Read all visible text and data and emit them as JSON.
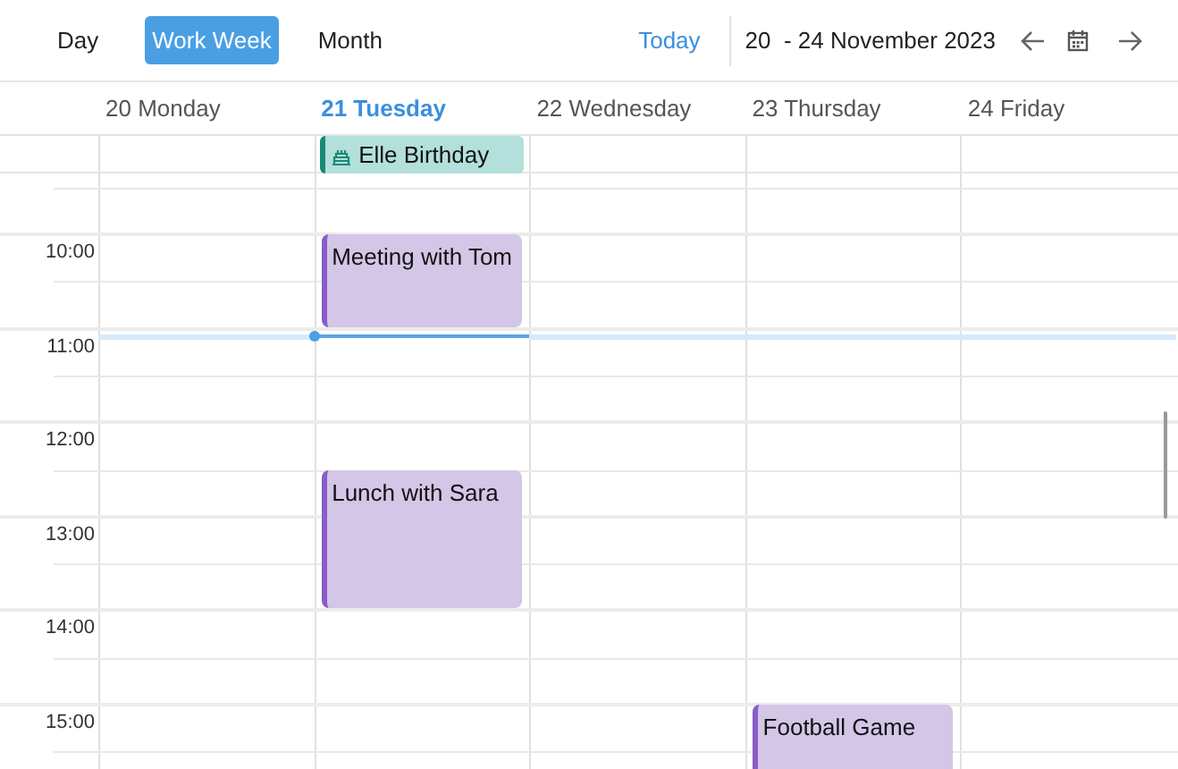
{
  "views": [
    {
      "label": "Day",
      "selected": false
    },
    {
      "label": "Work Week",
      "selected": true
    },
    {
      "label": "Month",
      "selected": false
    }
  ],
  "today_button": "Today",
  "date_range": "20  - 24 November 2023",
  "days": [
    {
      "label": "20 Monday",
      "selected": false
    },
    {
      "label": "21 Tuesday",
      "selected": true,
      "all_day_events": [
        {
          "title": "Elle Birthday",
          "color": "#1a8a78"
        }
      ],
      "events": [
        {
          "title": "Meeting with Tom",
          "color": "#8a5cc9"
        },
        {
          "title": "Lunch with Sara",
          "color": "#8a5cc9"
        }
      ]
    },
    {
      "label": "22 Wednesday",
      "selected": false
    },
    {
      "label": "23 Thursday",
      "selected": false,
      "events": [
        {
          "title": "Football Game",
          "color": "#8a5cc9"
        }
      ]
    },
    {
      "label": "24 Friday",
      "selected": false
    }
  ],
  "hours": [
    "10:00",
    "11:00",
    "12:00",
    "13:00",
    "14:00",
    "15:00"
  ]
}
